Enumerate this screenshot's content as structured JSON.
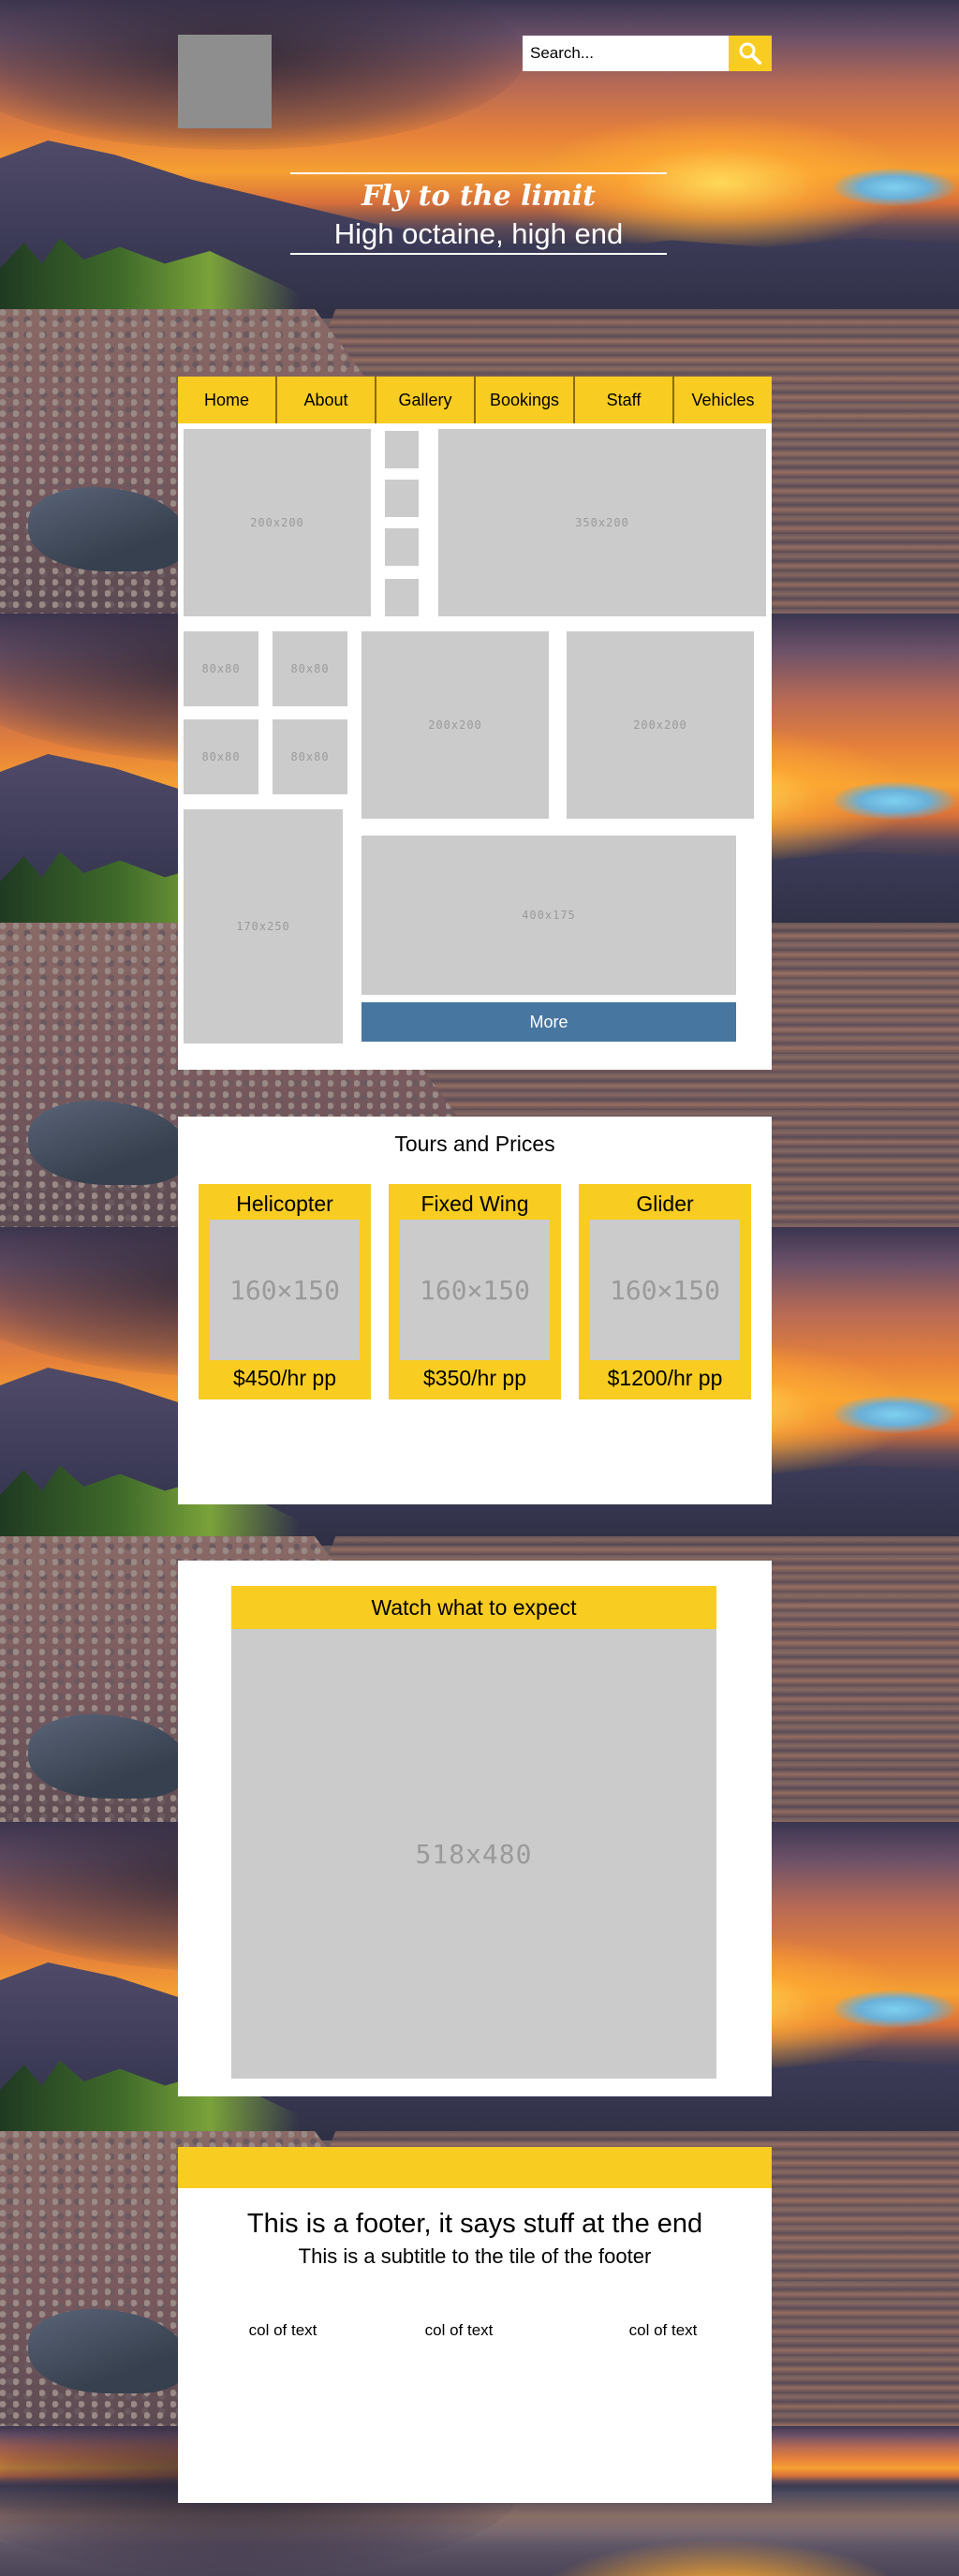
{
  "header": {
    "search": {
      "placeholder": "Search..."
    },
    "hero_title": "Fly to the limit",
    "hero_subtitle": "High octaine, high end"
  },
  "nav": {
    "items": [
      "Home",
      "About",
      "Gallery",
      "Bookings",
      "Staff",
      "Vehicles"
    ]
  },
  "gallery": {
    "placeholders": {
      "p200a": "200x200",
      "p350": "350x200",
      "p80a": "80x80",
      "p80b": "80x80",
      "p80c": "80x80",
      "p80d": "80x80",
      "p200b": "200x200",
      "p200c": "200x200",
      "p170": "170x250",
      "p400": "400x175"
    },
    "more_label": "More"
  },
  "tours": {
    "title": "Tours and Prices",
    "cards": [
      {
        "name": "Helicopter",
        "image": "160×150",
        "price": "$450/hr pp"
      },
      {
        "name": "Fixed Wing",
        "image": "160×150",
        "price": "$350/hr pp"
      },
      {
        "name": "Glider",
        "image": "160×150",
        "price": "$1200/hr pp"
      }
    ]
  },
  "video": {
    "title": "Watch what to expect",
    "placeholder": "518x480"
  },
  "footer": {
    "title": "This is a footer, it says stuff at the end",
    "subtitle": "This is a subtitle to the tile of the footer",
    "columns": [
      "col of text",
      "col of text",
      "col of text"
    ]
  },
  "colors": {
    "accent": "#f8cc21",
    "button": "#4776a1",
    "placeholder": "#cbcbcb",
    "logo": "#8e8e8e"
  }
}
